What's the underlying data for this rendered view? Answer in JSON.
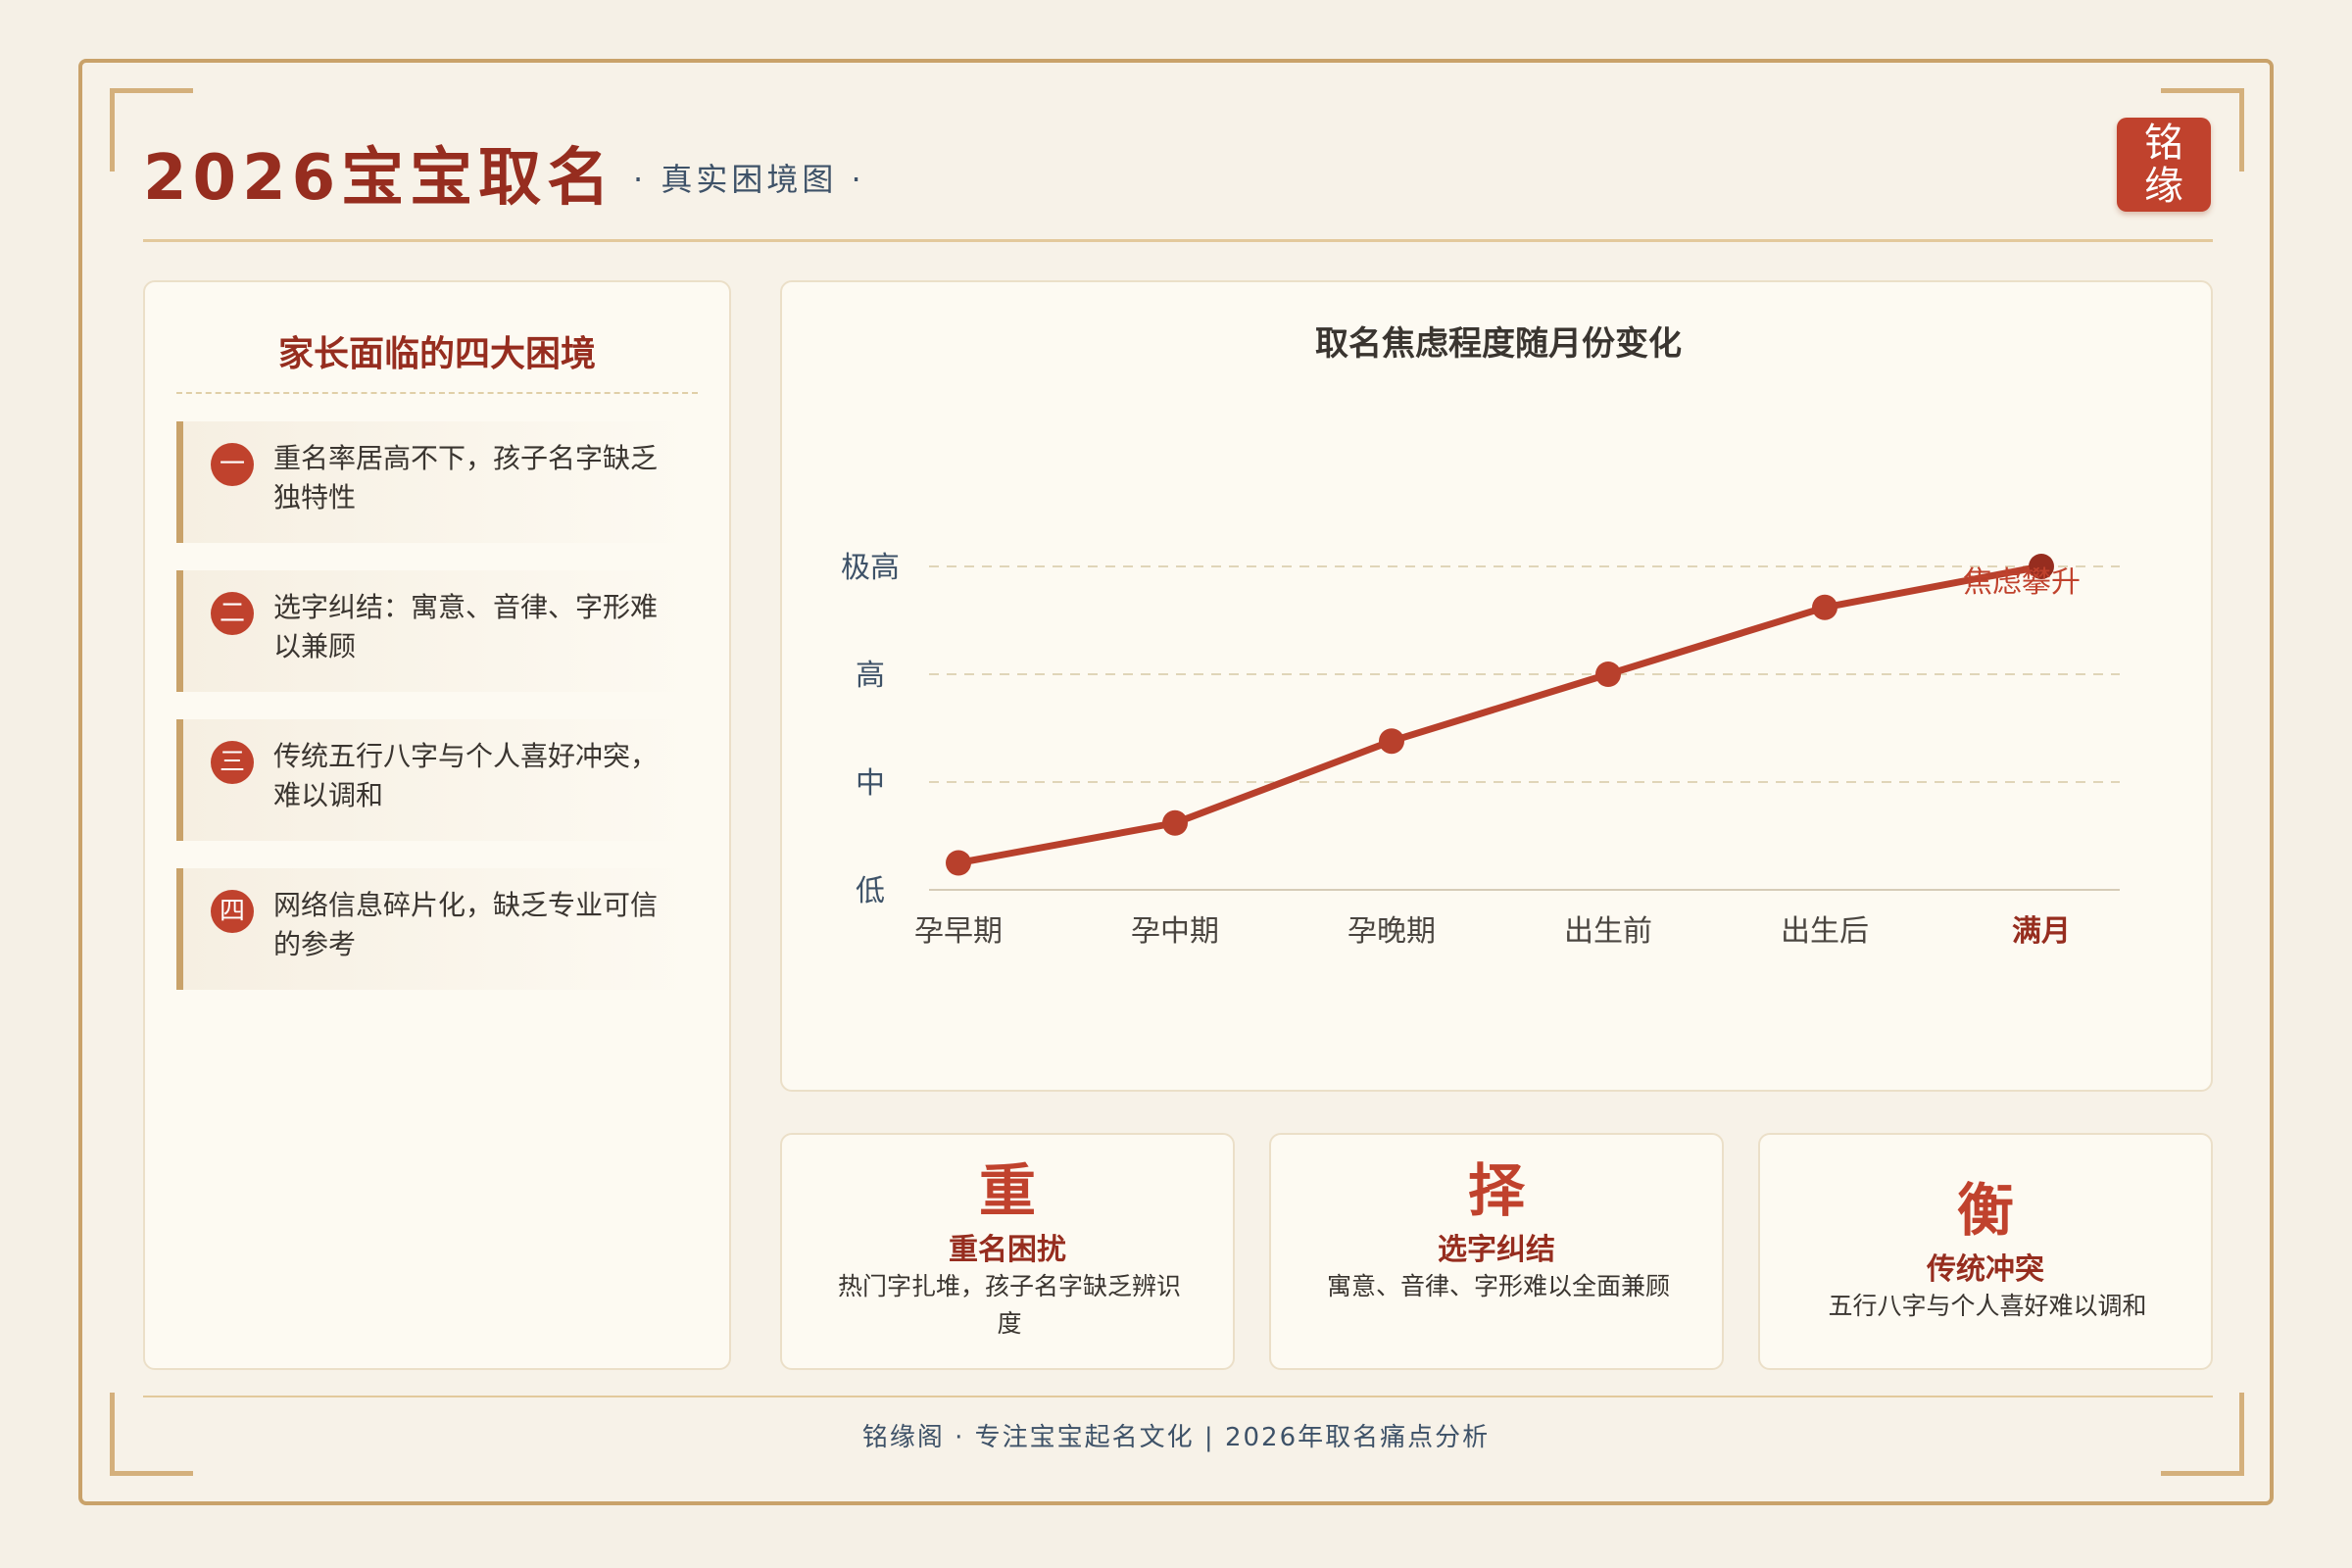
{
  "header": {
    "title": "2026宝宝取名",
    "subtitle": "· 真实困境图 ·",
    "seal_top": "铭",
    "seal_bottom": "缘"
  },
  "left_panel": {
    "title": "家长面临的四大困境",
    "items": [
      {
        "num": "一",
        "text": "重名率居高不下，孩子名字缺乏独特性"
      },
      {
        "num": "二",
        "text": "选字纠结：寓意、音律、字形难以兼顾"
      },
      {
        "num": "三",
        "text": "传统五行八字与个人喜好冲突，难以调和"
      },
      {
        "num": "四",
        "text": "网络信息碎片化，缺乏专业可信的参考"
      }
    ]
  },
  "chart_data": {
    "type": "line",
    "title": "取名焦虑程度随月份变化",
    "categories": [
      "孕早期",
      "孕中期",
      "孕晚期",
      "出生前",
      "出生后",
      "满月"
    ],
    "values": [
      0.25,
      0.62,
      1.38,
      2.0,
      2.62,
      3.0
    ],
    "y_ticks": [
      {
        "value": 0,
        "label": "低"
      },
      {
        "value": 1,
        "label": "中"
      },
      {
        "value": 2,
        "label": "高"
      },
      {
        "value": 3,
        "label": "极高"
      }
    ],
    "ylim": [
      0,
      3
    ],
    "annotation": "焦虑攀升",
    "highlight_category": "满月",
    "line_color": "#b8402c",
    "highlight_color": "#962d1f",
    "grid": true
  },
  "cards": [
    {
      "char": "重",
      "title": "重名困扰",
      "desc": "热门字扎堆，孩子名字缺乏辨识度"
    },
    {
      "char": "择",
      "title": "选字纠结",
      "desc": "寓意、音律、字形难以全面兼顾"
    },
    {
      "char": "衡",
      "title": "传统冲突",
      "desc": "五行八字与个人喜好难以调和"
    }
  ],
  "footer": "铭缘阁 · 专注宝宝起名文化 | 2026年取名痛点分析",
  "colors": {
    "primary": "#962d1f",
    "accent": "#c0422d",
    "gold": "#c9a26a",
    "background": "#f5f0e6"
  }
}
